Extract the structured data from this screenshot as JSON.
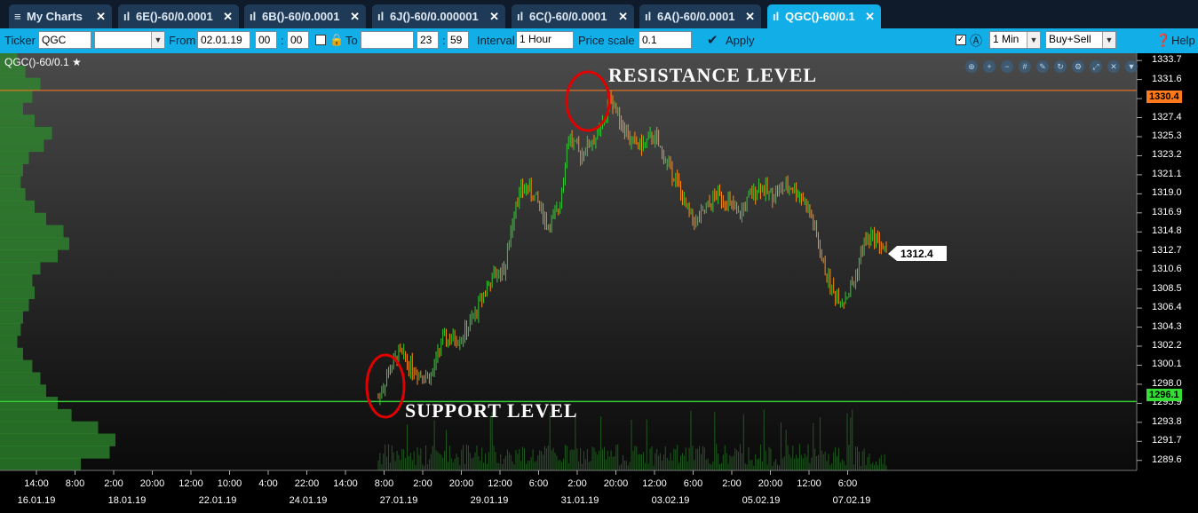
{
  "tabs": [
    {
      "label": "My Charts",
      "icon": "menu-icon"
    },
    {
      "label": "6E()-60/0.0001",
      "icon": "chart-icon"
    },
    {
      "label": "6B()-60/0.0001",
      "icon": "chart-icon"
    },
    {
      "label": "6J()-60/0.000001",
      "icon": "chart-icon"
    },
    {
      "label": "6C()-60/0.0001",
      "icon": "chart-icon"
    },
    {
      "label": "6A()-60/0.0001",
      "icon": "chart-icon"
    },
    {
      "label": "QGC()-60/0.1",
      "icon": "chart-icon",
      "active": true
    }
  ],
  "toolbar": {
    "ticker_label": "Ticker",
    "ticker_value": "QGC",
    "from_label": "From",
    "from_date": "02.01.19",
    "from_hour": "00",
    "from_min": "00",
    "to_label": "To",
    "to_date": "",
    "to_hour": "23",
    "to_min": "59",
    "interval_label": "Interval",
    "interval_value": "1 Hour",
    "price_scale_label": "Price scale",
    "price_scale_value": "0.1",
    "apply_label": "Apply",
    "mode_value": "1 Min",
    "side_value": "Buy+Sell",
    "help_label": "Help",
    "colon": ":"
  },
  "chart": {
    "title": "QGC()-60/0.1",
    "annotations": {
      "resistance": "RESISTANCE LEVEL",
      "support": "SUPPORT LEVEL"
    },
    "resistance_label": "1330.4",
    "support_label": "1296.1",
    "last_price_label": "1312.4",
    "colors": {
      "resistance": "#ff7a1a",
      "support": "#33cc33",
      "up": "#33cc33",
      "down": "#ff8c1a",
      "circle": "#e00000"
    }
  },
  "chart_data": {
    "type": "candlestick",
    "y_ticks": [
      "1333.7",
      "1331.6",
      "1329.5",
      "1327.4",
      "1325.3",
      "1323.2",
      "1321.1",
      "1319.0",
      "1316.9",
      "1314.8",
      "1312.7",
      "1310.6",
      "1308.5",
      "1306.4",
      "1304.3",
      "1302.2",
      "1300.1",
      "1298.0",
      "1295.9",
      "1293.8",
      "1291.7",
      "1289.6"
    ],
    "x_ticks": [
      "14:00",
      "8:00",
      "2:00",
      "20:00",
      "12:00",
      "10:00",
      "4:00",
      "22:00",
      "14:00",
      "8:00",
      "2:00",
      "20:00",
      "12:00",
      "6:00",
      "2:00",
      "20:00",
      "12:00",
      "6:00",
      "2:00",
      "20:00",
      "12:00",
      "6:00"
    ],
    "date_ticks": [
      "16.01.19",
      "18.01.19",
      "22.01.19",
      "24.01.19",
      "27.01.19",
      "29.01.19",
      "31.01.19",
      "03.02.19",
      "05.02.19",
      "07.02.19"
    ],
    "ylim": [
      1288.5,
      1334.5
    ],
    "resistance": 1330.4,
    "support": 1296.1,
    "last": 1312.4,
    "closes": [
      1296.5,
      1299.5,
      1301.5,
      1300.0,
      1299.2,
      1298.8,
      1302.8,
      1303.0,
      1303.3,
      1305.3,
      1308.2,
      1310.0,
      1310.8,
      1318.5,
      1319.8,
      1318.3,
      1315.5,
      1317.0,
      1325.5,
      1323.3,
      1324.6,
      1325.8,
      1329.7,
      1326.8,
      1324.6,
      1324.3,
      1325.4,
      1323.0,
      1321.0,
      1317.5,
      1315.8,
      1317.2,
      1319.0,
      1318.2,
      1316.5,
      1318.4,
      1320.0,
      1318.9,
      1319.4,
      1319.8,
      1318.8,
      1316.2,
      1311.3,
      1308.0,
      1307.3,
      1309.5,
      1314.0,
      1314.2,
      1312.4
    ],
    "volume_profile": [
      0.15,
      0.22,
      0.35,
      0.28,
      0.2,
      0.3,
      0.45,
      0.38,
      0.25,
      0.2,
      0.18,
      0.22,
      0.3,
      0.4,
      0.55,
      0.6,
      0.5,
      0.35,
      0.28,
      0.3,
      0.25,
      0.2,
      0.18,
      0.15,
      0.2,
      0.28,
      0.35,
      0.4,
      0.5,
      0.62,
      0.85,
      1.0,
      0.95,
      0.7
    ]
  }
}
